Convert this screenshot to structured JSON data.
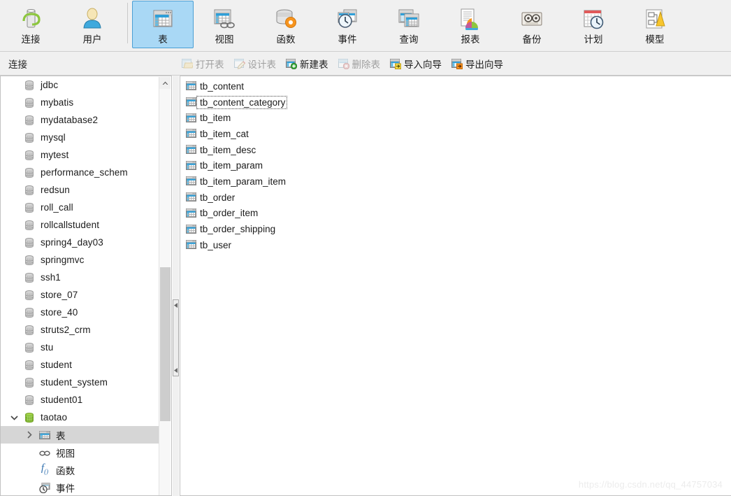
{
  "ribbon": {
    "items": [
      {
        "label": "连接",
        "icon": "connection-icon",
        "selected": false
      },
      {
        "label": "用户",
        "icon": "user-icon",
        "selected": false
      },
      {
        "label": "表",
        "icon": "table-icon",
        "selected": true
      },
      {
        "label": "视图",
        "icon": "view-icon",
        "selected": false
      },
      {
        "label": "函数",
        "icon": "function-icon",
        "selected": false
      },
      {
        "label": "事件",
        "icon": "event-icon",
        "selected": false
      },
      {
        "label": "查询",
        "icon": "query-icon",
        "selected": false
      },
      {
        "label": "报表",
        "icon": "report-icon",
        "selected": false
      },
      {
        "label": "备份",
        "icon": "backup-icon",
        "selected": false
      },
      {
        "label": "计划",
        "icon": "schedule-icon",
        "selected": false
      },
      {
        "label": "模型",
        "icon": "model-icon",
        "selected": false
      }
    ]
  },
  "subbar": {
    "panel_title": "连接",
    "buttons": [
      {
        "label": "打开表",
        "icon": "open-table-icon",
        "enabled": false
      },
      {
        "label": "设计表",
        "icon": "design-table-icon",
        "enabled": false
      },
      {
        "label": "新建表",
        "icon": "new-table-icon",
        "enabled": true
      },
      {
        "label": "删除表",
        "icon": "delete-table-icon",
        "enabled": false
      },
      {
        "label": "导入向导",
        "icon": "import-wizard-icon",
        "enabled": true
      },
      {
        "label": "导出向导",
        "icon": "export-wizard-icon",
        "enabled": true
      }
    ]
  },
  "sidebar": {
    "items": [
      {
        "label": "jdbc",
        "icon": "database-icon",
        "level": 1,
        "state": "closed",
        "chevron": "none",
        "selected": false
      },
      {
        "label": "mybatis",
        "icon": "database-icon",
        "level": 1,
        "state": "closed",
        "chevron": "none",
        "selected": false
      },
      {
        "label": "mydatabase2",
        "icon": "database-icon",
        "level": 1,
        "state": "closed",
        "chevron": "none",
        "selected": false
      },
      {
        "label": "mysql",
        "icon": "database-icon",
        "level": 1,
        "state": "closed",
        "chevron": "none",
        "selected": false
      },
      {
        "label": "mytest",
        "icon": "database-icon",
        "level": 1,
        "state": "closed",
        "chevron": "none",
        "selected": false
      },
      {
        "label": "performance_schem",
        "icon": "database-icon",
        "level": 1,
        "state": "closed",
        "chevron": "none",
        "selected": false
      },
      {
        "label": "redsun",
        "icon": "database-icon",
        "level": 1,
        "state": "closed",
        "chevron": "none",
        "selected": false
      },
      {
        "label": "roll_call",
        "icon": "database-icon",
        "level": 1,
        "state": "closed",
        "chevron": "none",
        "selected": false
      },
      {
        "label": "rollcallstudent",
        "icon": "database-icon",
        "level": 1,
        "state": "closed",
        "chevron": "none",
        "selected": false
      },
      {
        "label": "spring4_day03",
        "icon": "database-icon",
        "level": 1,
        "state": "closed",
        "chevron": "none",
        "selected": false
      },
      {
        "label": "springmvc",
        "icon": "database-icon",
        "level": 1,
        "state": "closed",
        "chevron": "none",
        "selected": false
      },
      {
        "label": "ssh1",
        "icon": "database-icon",
        "level": 1,
        "state": "closed",
        "chevron": "none",
        "selected": false
      },
      {
        "label": "store_07",
        "icon": "database-icon",
        "level": 1,
        "state": "closed",
        "chevron": "none",
        "selected": false
      },
      {
        "label": "store_40",
        "icon": "database-icon",
        "level": 1,
        "state": "closed",
        "chevron": "none",
        "selected": false
      },
      {
        "label": "struts2_crm",
        "icon": "database-icon",
        "level": 1,
        "state": "closed",
        "chevron": "none",
        "selected": false
      },
      {
        "label": "stu",
        "icon": "database-icon",
        "level": 1,
        "state": "closed",
        "chevron": "none",
        "selected": false
      },
      {
        "label": "student",
        "icon": "database-icon",
        "level": 1,
        "state": "closed",
        "chevron": "none",
        "selected": false
      },
      {
        "label": "student_system",
        "icon": "database-icon",
        "level": 1,
        "state": "closed",
        "chevron": "none",
        "selected": false
      },
      {
        "label": "student01",
        "icon": "database-icon",
        "level": 1,
        "state": "closed",
        "chevron": "none",
        "selected": false
      },
      {
        "label": "taotao",
        "icon": "database-open-icon",
        "level": 1,
        "state": "open",
        "chevron": "down",
        "selected": false
      },
      {
        "label": "表",
        "icon": "table-node-icon",
        "level": 2,
        "state": "closed",
        "chevron": "right",
        "selected": true
      },
      {
        "label": "视图",
        "icon": "view-node-icon",
        "level": 2,
        "state": "closed",
        "chevron": "none",
        "selected": false
      },
      {
        "label": "函数",
        "icon": "function-node-icon",
        "level": 2,
        "state": "closed",
        "chevron": "none",
        "selected": false
      },
      {
        "label": "事件",
        "icon": "event-node-icon",
        "level": 2,
        "state": "closed",
        "chevron": "none",
        "selected": false
      }
    ]
  },
  "content": {
    "tables": [
      {
        "name": "tb_content",
        "icon": "table-item-icon",
        "focused": false
      },
      {
        "name": "tb_content_category",
        "icon": "table-item-icon",
        "focused": true
      },
      {
        "name": "tb_item",
        "icon": "table-item-icon",
        "focused": false
      },
      {
        "name": "tb_item_cat",
        "icon": "table-item-icon",
        "focused": false
      },
      {
        "name": "tb_item_desc",
        "icon": "table-item-icon",
        "focused": false
      },
      {
        "name": "tb_item_param",
        "icon": "table-item-icon",
        "focused": false
      },
      {
        "name": "tb_item_param_item",
        "icon": "table-item-icon",
        "focused": false
      },
      {
        "name": "tb_order",
        "icon": "table-item-icon",
        "focused": false
      },
      {
        "name": "tb_order_item",
        "icon": "table-item-icon",
        "focused": false
      },
      {
        "name": "tb_order_shipping",
        "icon": "table-item-icon",
        "focused": false
      },
      {
        "name": "tb_user",
        "icon": "table-item-icon",
        "focused": false
      }
    ]
  },
  "watermark": {
    "text": "https://blog.csdn.net/qq_44757034"
  },
  "colors": {
    "ribbon_bg": "#f0f0f0",
    "selected_tab_bg": "#a9d8f5",
    "selected_tab_border": "#4a9fd4",
    "tree_selection_bg": "#d6d6d6",
    "table_icon_blue": "#2f9fd8",
    "db_open_green": "#8dc63f",
    "watermark_gray": "#ececec"
  }
}
